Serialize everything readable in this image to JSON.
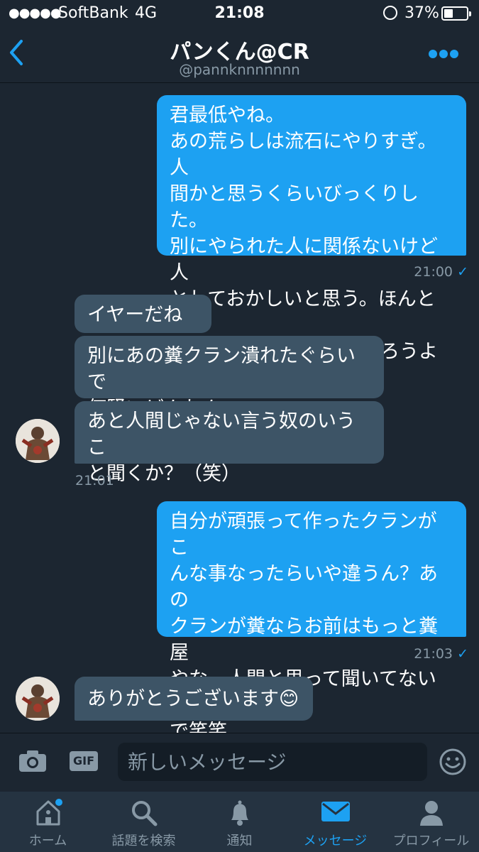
{
  "status_bar": {
    "carrier": "SoftBank",
    "network": "4G",
    "time": "21:08",
    "battery_percent": "37%",
    "battery_level": 0.37
  },
  "header": {
    "title": "パンくん@CR",
    "handle": "@pannknnnnnnn"
  },
  "messages": [
    {
      "direction": "out",
      "text": [
        "君最低やね。",
        "あの荒らしは流石にやりすぎ。人",
        "間かと思うくらいびっくりした。",
        "別にやられた人に関係ないけど人",
        "としておかしいと思う。ほんと残",
        "虐すぎる。自分の力で謝ろうよ"
      ],
      "time": "21:00"
    },
    {
      "direction": "in",
      "text": [
        "イヤーだねー"
      ]
    },
    {
      "direction": "in",
      "text": [
        "別にあの糞クラン潰れたぐらいで",
        "何騒いどんねん"
      ]
    },
    {
      "direction": "in",
      "text": [
        "あと人間じゃない言う奴のいうこ",
        "と聞くか？（笑）"
      ],
      "time": "21:01"
    },
    {
      "direction": "out",
      "text": [
        "自分が頑張って作ったクランがこ",
        "んな事なったらいや違うん？あの",
        "クランが糞ならお前はもっと糞屋",
        "やな。人間と思って聞いてないの",
        "で笑笑"
      ],
      "time": "21:03"
    },
    {
      "direction": "in",
      "text": [
        "ありがとうございます😊"
      ]
    }
  ],
  "compose": {
    "placeholder": "新しいメッセージ",
    "gif_label": "GIF"
  },
  "tabs": [
    {
      "label": "ホーム",
      "icon": "home-icon",
      "badge": true
    },
    {
      "label": "話題を検索",
      "icon": "search-icon"
    },
    {
      "label": "通知",
      "icon": "bell-icon"
    },
    {
      "label": "メッセージ",
      "icon": "envelope-icon",
      "active": true
    },
    {
      "label": "プロフィール",
      "icon": "person-icon"
    }
  ],
  "colors": {
    "background": "#1c2631",
    "accent": "#1da1f2",
    "incoming_bubble": "#3d5466",
    "muted_text": "#8899a6",
    "tab_bar": "#253341"
  }
}
